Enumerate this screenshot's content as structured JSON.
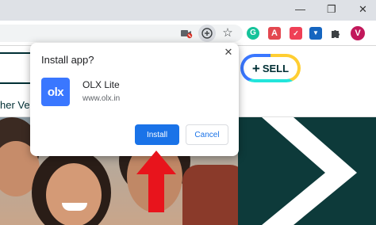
{
  "window_controls": {
    "minimize": "—",
    "maximize": "❐",
    "close": "✕"
  },
  "toolbar": {
    "icons": [
      "blocked-camera-icon",
      "install-app-icon",
      "bookmark-star-icon",
      "grammarly-extension-icon",
      "acrobat-extension-icon",
      "pocket-extension-icon",
      "save-extension-icon",
      "extensions-puzzle-icon"
    ],
    "ext_letters": {
      "grammarly": "G",
      "acrobat": "A",
      "pocket": "✓",
      "save": "▼"
    },
    "avatar_letter": "V",
    "colors": {
      "grammarly": "#15c39a",
      "acrobat": "#e34850",
      "pocket": "#ef4056",
      "save": "#1565c0"
    }
  },
  "page": {
    "sell_label": "SELL",
    "sell_plus": "+",
    "category_fragment": "her Vehi",
    "brand_teal": "#002f34"
  },
  "dialog": {
    "title": "Install app?",
    "close_glyph": "✕",
    "app_icon_text": "olx",
    "app_name": "OLX Lite",
    "app_url": "www.olx.in",
    "install_label": "Install",
    "cancel_label": "Cancel",
    "accent": "#1a73e8"
  }
}
